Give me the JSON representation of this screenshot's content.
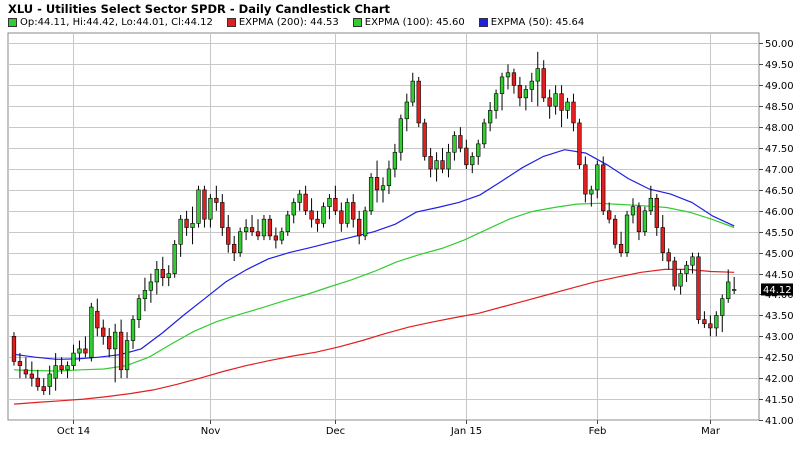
{
  "title": "XLU - Utilities Select Sector SPDR - Daily Candlestick Chart",
  "legend": [
    {
      "label": "Op:44.11, Hi:44.42, Lo:44.01, Cl:44.12",
      "color": "#33cc33"
    },
    {
      "label": "EXPMA (200): 44.53",
      "color": "#e02020"
    },
    {
      "label": "EXPMA (100): 45.60",
      "color": "#33cc33"
    },
    {
      "label": "EXPMA (50): 45.64",
      "color": "#2020e0"
    }
  ],
  "chart_data": {
    "type": "candlestick",
    "x_tick_labels": [
      "Oct 14",
      "Nov",
      "Dec",
      "Jan 15",
      "Feb",
      "Mar"
    ],
    "x_tick_index": [
      10,
      33,
      54,
      76,
      98,
      117
    ],
    "y_ticks": [
      41.0,
      41.5,
      42.0,
      42.5,
      43.0,
      43.5,
      44.0,
      44.5,
      45.0,
      45.5,
      46.0,
      46.5,
      47.0,
      47.5,
      48.0,
      48.5,
      49.0,
      49.5,
      50.0
    ],
    "ylim": [
      41.0,
      50.25
    ],
    "last_price": "44.12",
    "colors": {
      "up": "#33cc33",
      "down": "#e02020",
      "ema200": "#e02020",
      "ema100": "#33cc33",
      "ema50": "#2020e0"
    },
    "candles": [
      [
        43.0,
        43.1,
        42.3,
        42.4
      ],
      [
        42.4,
        42.6,
        42.0,
        42.3
      ],
      [
        42.2,
        42.5,
        42.0,
        42.1
      ],
      [
        42.1,
        42.4,
        41.8,
        42.0
      ],
      [
        42.0,
        42.2,
        41.7,
        41.8
      ],
      [
        41.8,
        42.0,
        41.6,
        41.7
      ],
      [
        41.8,
        42.3,
        41.6,
        42.1
      ],
      [
        42.0,
        42.6,
        41.7,
        42.3
      ],
      [
        42.3,
        42.5,
        42.1,
        42.2
      ],
      [
        42.2,
        42.4,
        42.0,
        42.3
      ],
      [
        42.3,
        42.8,
        42.2,
        42.6
      ],
      [
        42.6,
        42.9,
        42.4,
        42.7
      ],
      [
        42.7,
        43.0,
        42.5,
        42.6
      ],
      [
        42.5,
        43.8,
        42.4,
        43.7
      ],
      [
        43.6,
        43.9,
        43.0,
        43.2
      ],
      [
        43.2,
        43.4,
        42.8,
        43.0
      ],
      [
        43.0,
        43.2,
        42.5,
        42.7
      ],
      [
        42.7,
        43.3,
        41.9,
        43.1
      ],
      [
        43.1,
        43.4,
        42.0,
        42.2
      ],
      [
        42.2,
        43.1,
        42.0,
        42.9
      ],
      [
        42.9,
        43.5,
        42.7,
        43.4
      ],
      [
        43.4,
        44.0,
        43.2,
        43.9
      ],
      [
        43.9,
        44.4,
        43.6,
        44.1
      ],
      [
        44.1,
        44.5,
        43.8,
        44.3
      ],
      [
        44.3,
        44.8,
        44.0,
        44.6
      ],
      [
        44.6,
        44.9,
        44.2,
        44.4
      ],
      [
        44.4,
        44.7,
        44.2,
        44.5
      ],
      [
        44.5,
        45.3,
        44.4,
        45.2
      ],
      [
        45.2,
        45.9,
        44.9,
        45.8
      ],
      [
        45.8,
        46.0,
        45.4,
        45.6
      ],
      [
        45.6,
        46.1,
        45.2,
        45.7
      ],
      [
        45.7,
        46.6,
        45.6,
        46.5
      ],
      [
        46.5,
        46.6,
        45.6,
        45.8
      ],
      [
        45.8,
        46.4,
        45.6,
        46.3
      ],
      [
        46.3,
        46.6,
        46.0,
        46.2
      ],
      [
        46.2,
        46.4,
        45.4,
        45.6
      ],
      [
        45.6,
        45.9,
        45.0,
        45.2
      ],
      [
        45.2,
        45.4,
        44.8,
        45.0
      ],
      [
        45.0,
        45.6,
        44.9,
        45.5
      ],
      [
        45.5,
        45.8,
        45.3,
        45.6
      ],
      [
        45.6,
        45.9,
        45.4,
        45.5
      ],
      [
        45.5,
        45.8,
        45.3,
        45.4
      ],
      [
        45.4,
        45.9,
        45.3,
        45.8
      ],
      [
        45.8,
        45.9,
        45.3,
        45.4
      ],
      [
        45.4,
        45.6,
        45.1,
        45.3
      ],
      [
        45.3,
        45.6,
        45.2,
        45.5
      ],
      [
        45.5,
        46.0,
        45.4,
        45.9
      ],
      [
        45.9,
        46.3,
        45.7,
        46.2
      ],
      [
        46.2,
        46.5,
        46.0,
        46.4
      ],
      [
        46.4,
        46.6,
        45.9,
        46.0
      ],
      [
        46.0,
        46.3,
        45.6,
        45.8
      ],
      [
        45.8,
        46.0,
        45.5,
        45.7
      ],
      [
        45.7,
        46.2,
        45.6,
        46.1
      ],
      [
        46.1,
        46.4,
        45.8,
        46.3
      ],
      [
        46.3,
        46.6,
        45.9,
        46.0
      ],
      [
        46.0,
        46.2,
        45.5,
        45.7
      ],
      [
        45.7,
        46.3,
        45.6,
        46.2
      ],
      [
        46.2,
        46.4,
        45.6,
        45.8
      ],
      [
        45.8,
        46.0,
        45.2,
        45.4
      ],
      [
        45.4,
        46.1,
        45.3,
        46.0
      ],
      [
        46.0,
        46.9,
        45.9,
        46.8
      ],
      [
        46.8,
        47.2,
        46.2,
        46.5
      ],
      [
        46.5,
        46.8,
        46.2,
        46.6
      ],
      [
        46.6,
        47.2,
        46.4,
        47.0
      ],
      [
        47.0,
        47.6,
        46.8,
        47.4
      ],
      [
        47.4,
        48.3,
        47.2,
        48.2
      ],
      [
        48.2,
        48.8,
        47.9,
        48.6
      ],
      [
        48.6,
        49.3,
        48.5,
        49.1
      ],
      [
        49.1,
        49.2,
        48.0,
        48.1
      ],
      [
        48.1,
        48.2,
        47.2,
        47.3
      ],
      [
        47.3,
        47.5,
        46.8,
        47.0
      ],
      [
        47.0,
        47.4,
        46.7,
        47.2
      ],
      [
        47.2,
        47.5,
        46.9,
        47.0
      ],
      [
        47.0,
        47.6,
        46.8,
        47.4
      ],
      [
        47.4,
        47.9,
        47.2,
        47.8
      ],
      [
        47.8,
        48.0,
        47.4,
        47.5
      ],
      [
        47.5,
        47.7,
        47.0,
        47.1
      ],
      [
        47.1,
        47.4,
        46.9,
        47.3
      ],
      [
        47.3,
        47.7,
        47.1,
        47.6
      ],
      [
        47.6,
        48.2,
        47.5,
        48.1
      ],
      [
        48.1,
        48.6,
        47.9,
        48.4
      ],
      [
        48.4,
        48.9,
        48.2,
        48.8
      ],
      [
        48.8,
        49.3,
        48.4,
        49.2
      ],
      [
        49.2,
        49.5,
        48.9,
        49.3
      ],
      [
        49.3,
        49.4,
        48.8,
        49.0
      ],
      [
        49.0,
        49.2,
        48.5,
        48.7
      ],
      [
        48.7,
        49.0,
        48.4,
        48.9
      ],
      [
        48.9,
        49.3,
        48.6,
        49.1
      ],
      [
        49.1,
        49.8,
        48.5,
        49.4
      ],
      [
        49.4,
        49.6,
        48.6,
        48.7
      ],
      [
        48.7,
        48.9,
        48.2,
        48.5
      ],
      [
        48.5,
        49.0,
        48.3,
        48.8
      ],
      [
        48.8,
        49.0,
        48.0,
        48.4
      ],
      [
        48.4,
        48.7,
        48.2,
        48.6
      ],
      [
        48.6,
        48.8,
        47.9,
        48.1
      ],
      [
        48.1,
        48.2,
        47.0,
        47.1
      ],
      [
        47.1,
        47.3,
        46.2,
        46.4
      ],
      [
        46.4,
        46.6,
        46.1,
        46.5
      ],
      [
        46.5,
        47.2,
        46.3,
        47.1
      ],
      [
        47.1,
        47.3,
        45.9,
        46.0
      ],
      [
        46.0,
        46.2,
        45.7,
        45.8
      ],
      [
        45.8,
        45.9,
        45.1,
        45.2
      ],
      [
        45.2,
        45.5,
        44.9,
        45.0
      ],
      [
        45.0,
        46.0,
        44.9,
        45.9
      ],
      [
        45.9,
        46.3,
        45.7,
        46.1
      ],
      [
        46.1,
        46.2,
        45.3,
        45.5
      ],
      [
        45.5,
        46.1,
        45.4,
        46.0
      ],
      [
        46.0,
        46.6,
        45.9,
        46.3
      ],
      [
        46.3,
        46.4,
        45.4,
        45.6
      ],
      [
        45.6,
        45.9,
        44.8,
        45.0
      ],
      [
        45.0,
        45.1,
        44.6,
        44.8
      ],
      [
        44.8,
        44.9,
        44.1,
        44.2
      ],
      [
        44.2,
        44.6,
        44.0,
        44.5
      ],
      [
        44.5,
        44.8,
        44.3,
        44.7
      ],
      [
        44.7,
        45.0,
        44.5,
        44.9
      ],
      [
        44.9,
        45.0,
        43.3,
        43.4
      ],
      [
        43.4,
        43.6,
        43.2,
        43.3
      ],
      [
        43.3,
        43.5,
        43.0,
        43.2
      ],
      [
        43.2,
        43.6,
        43.0,
        43.5
      ],
      [
        43.5,
        44.0,
        43.1,
        43.9
      ],
      [
        43.9,
        44.6,
        43.8,
        44.3
      ],
      [
        44.11,
        44.42,
        44.01,
        44.12
      ]
    ],
    "ema200": [
      41.38,
      41.42,
      41.46,
      41.5,
      41.56,
      41.63,
      41.72,
      41.85,
      42.0,
      42.16,
      42.3,
      42.42,
      42.53,
      42.62,
      42.75,
      42.9,
      43.07,
      43.22,
      43.34,
      43.45,
      43.55,
      43.7,
      43.85,
      44.0,
      44.15,
      44.3,
      44.42,
      44.53,
      44.6,
      44.6,
      44.55,
      44.53
    ],
    "ema100": [
      42.2,
      42.18,
      42.17,
      42.2,
      42.22,
      42.3,
      42.5,
      42.82,
      43.12,
      43.35,
      43.52,
      43.68,
      43.85,
      44.0,
      44.18,
      44.35,
      44.55,
      44.78,
      44.95,
      45.1,
      45.3,
      45.55,
      45.8,
      45.98,
      46.08,
      46.16,
      46.18,
      46.15,
      46.12,
      46.08,
      45.97,
      45.8,
      45.6
    ],
    "ema50": [
      42.57,
      42.5,
      42.45,
      42.46,
      42.5,
      42.56,
      42.7,
      43.08,
      43.5,
      43.9,
      44.3,
      44.6,
      44.85,
      45.0,
      45.12,
      45.25,
      45.38,
      45.5,
      45.68,
      45.97,
      46.08,
      46.2,
      46.38,
      46.7,
      47.03,
      47.3,
      47.46,
      47.38,
      47.1,
      46.77,
      46.52,
      46.4,
      46.2,
      45.87,
      45.64
    ]
  }
}
